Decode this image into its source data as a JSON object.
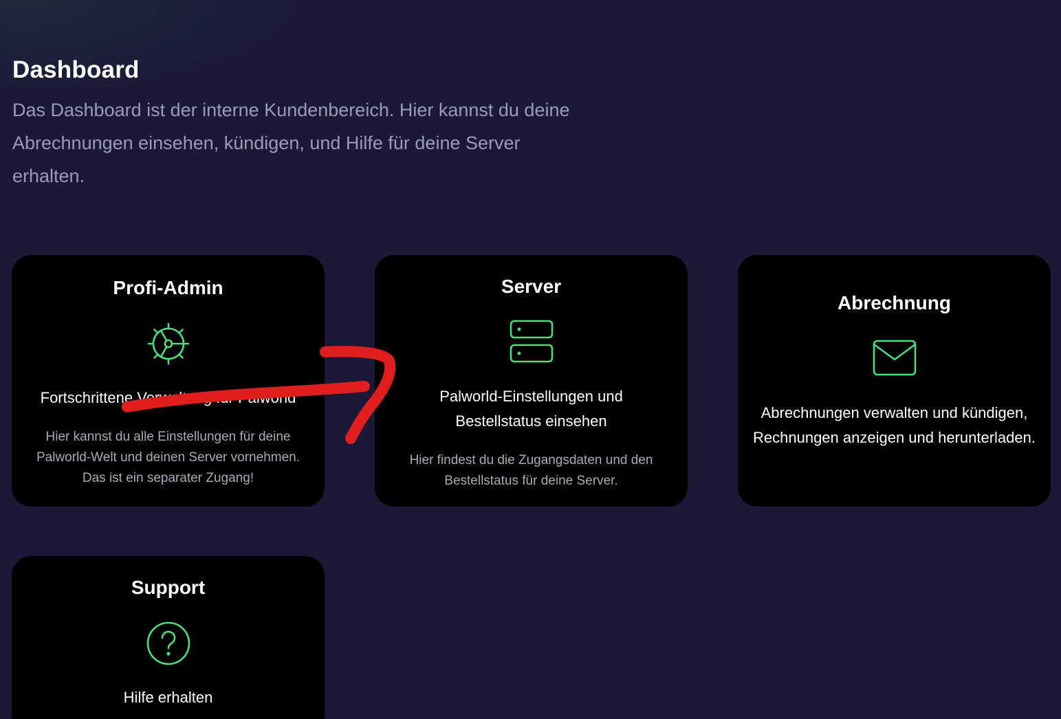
{
  "header": {
    "title": "Dashboard",
    "intro": "Das Dashboard ist der interne Kundenbereich. Hier kannst du deine Abrechnungen einsehen, kündigen, und Hilfe für deine Server erhalten."
  },
  "cards": {
    "profi_admin": {
      "title": "Profi-Admin",
      "icon": "gear-icon",
      "subtitle": "Fortschrittene Verwaltung für Palworld",
      "description": "Hier kannst du alle Einstellungen für deine Palworld-Welt und deinen Server vornehmen. Das ist ein separater Zugang!"
    },
    "server": {
      "title": "Server",
      "icon": "server-icon",
      "subtitle": "Palworld-Einstellungen und Bestellstatus einsehen",
      "description": "Hier findest du die Zugangsdaten und den Bestellstatus für deine Server."
    },
    "billing": {
      "title": "Abrechnung",
      "icon": "mail-icon",
      "subtitle": "Abrechnungen verwalten und kündigen, Rechnungen anzeigen und herunterladen."
    },
    "support": {
      "title": "Support",
      "icon": "help-circle-icon",
      "subtitle": "Hilfe erhalten"
    }
  },
  "colors": {
    "background": "#1b1a36",
    "card": "#000000",
    "icon_accent": "#4ade80",
    "muted_text": "#9a9cb3",
    "annotation": "#e01e1e"
  },
  "annotation": {
    "type": "hand-drawn arrow",
    "color": "#e01e1e"
  }
}
